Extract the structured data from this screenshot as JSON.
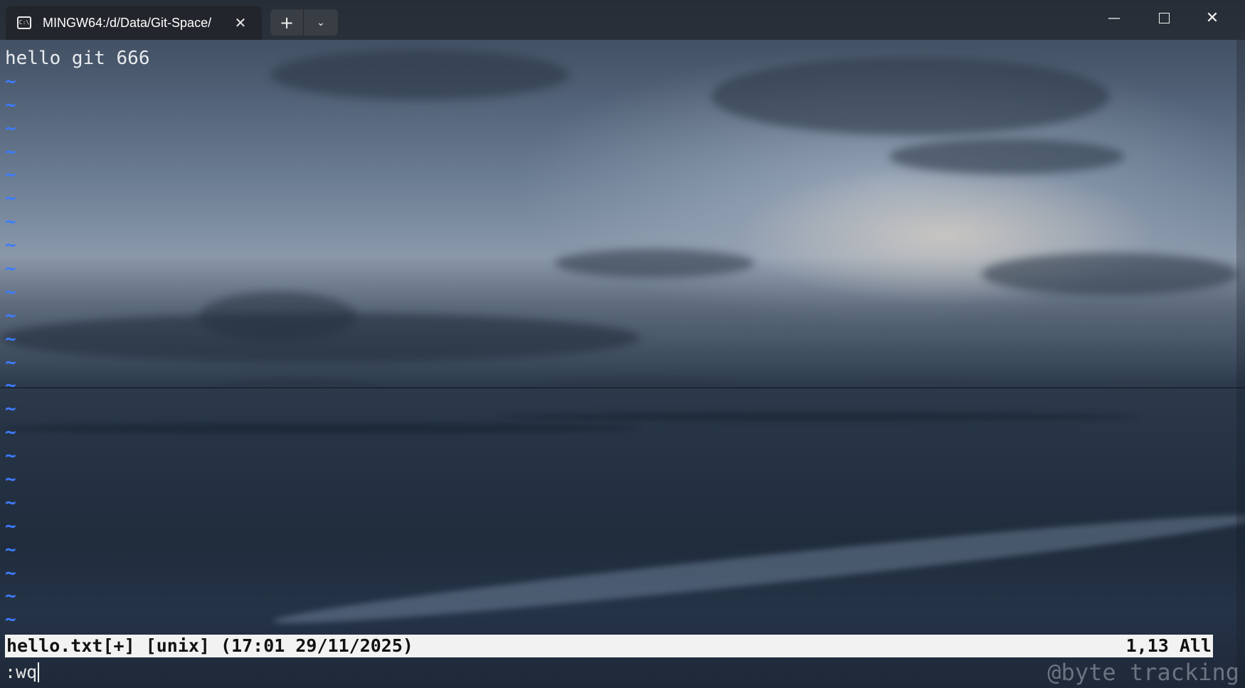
{
  "window": {
    "tab_title": "MINGW64:/d/Data/Git-Space/",
    "tab_icon": "terminal-icon",
    "tab_icon_text": "C:\\",
    "new_tab_symbol": "+",
    "dropdown_symbol": "⌄",
    "close_tab_symbol": "✕",
    "minimize_symbol": "—",
    "close_window_symbol": "✕"
  },
  "editor": {
    "lines": [
      "hello git 666"
    ],
    "tilde": "~",
    "tilde_count": 24,
    "tilde_color": "#3d7cff"
  },
  "statusline": {
    "left": "hello.txt[+] [unix] (17:01 29/11/2025)",
    "right": "1,13 All"
  },
  "cmdline": {
    "text": ":wq"
  },
  "watermark": "@byte tracking"
}
